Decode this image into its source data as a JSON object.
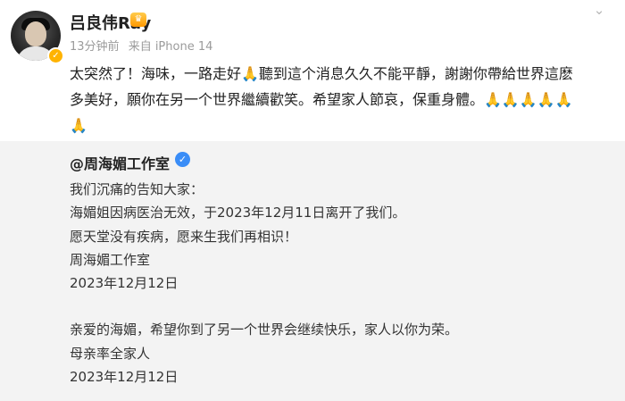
{
  "header": {
    "username": "吕良伟Ray",
    "meta_time": "13分钟前",
    "meta_source": "来自 iPhone 14"
  },
  "post": {
    "lines": [
      "太突然了！海味，一路走好🙏聽到這个消息久久不能平靜，謝謝你帶給世界這麽",
      "多美好，願你在另一个世界繼續歡笑。希望家人節哀，保重身體。🙏🙏🙏🙏🙏",
      "🙏"
    ]
  },
  "repost": {
    "org_name": "@周海媚工作室",
    "paragraph1": [
      "我们沉痛的告知大家：",
      "海媚姐因病医治无效，于2023年12月11日离开了我们。",
      "愿天堂没有疾病，愿来生我们再相识！",
      "周海媚工作室",
      "2023年12月12日"
    ],
    "paragraph2": [
      "亲爱的海媚，希望你到了另一个世界会继续快乐，家人以你为荣。",
      "母亲率全家人",
      "2023年12月12日"
    ]
  },
  "colors": {
    "repost_bg": "#f3f3f3",
    "meta_gray": "#9b9b9b",
    "verify_orange": "#ffb300",
    "verify_blue": "#3a8df7"
  }
}
